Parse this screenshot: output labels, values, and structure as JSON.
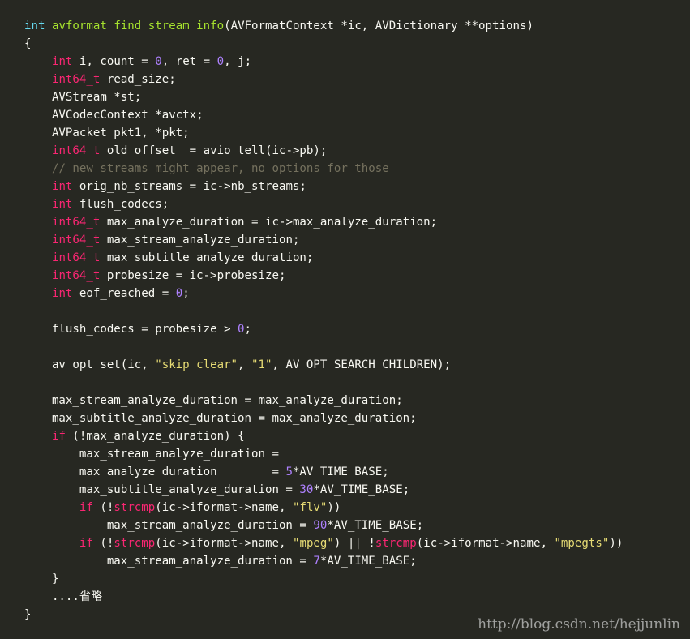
{
  "code": {
    "lines": [
      [
        {
          "t": "int",
          "c": "kw"
        },
        {
          "t": " "
        },
        {
          "t": "avformat_find_stream_info",
          "c": "fn"
        },
        {
          "t": "(AVFormatContext *ic, AVDictionary **options)"
        }
      ],
      [
        {
          "t": "{"
        }
      ],
      [
        {
          "t": "    "
        },
        {
          "t": "int",
          "c": "ty"
        },
        {
          "t": " i, count = "
        },
        {
          "t": "0",
          "c": "num"
        },
        {
          "t": ", ret = "
        },
        {
          "t": "0",
          "c": "num"
        },
        {
          "t": ", j;"
        }
      ],
      [
        {
          "t": "    "
        },
        {
          "t": "int64_t",
          "c": "ty"
        },
        {
          "t": " read_size;"
        }
      ],
      [
        {
          "t": "    AVStream *st;"
        }
      ],
      [
        {
          "t": "    AVCodecContext *avctx;"
        }
      ],
      [
        {
          "t": "    AVPacket pkt1, *pkt;"
        }
      ],
      [
        {
          "t": "    "
        },
        {
          "t": "int64_t",
          "c": "ty"
        },
        {
          "t": " old_offset  = avio_tell(ic->pb);"
        }
      ],
      [
        {
          "t": "    "
        },
        {
          "t": "// new streams might appear, no options for those",
          "c": "cm"
        }
      ],
      [
        {
          "t": "    "
        },
        {
          "t": "int",
          "c": "ty"
        },
        {
          "t": " orig_nb_streams = ic->nb_streams;"
        }
      ],
      [
        {
          "t": "    "
        },
        {
          "t": "int",
          "c": "ty"
        },
        {
          "t": " flush_codecs;"
        }
      ],
      [
        {
          "t": "    "
        },
        {
          "t": "int64_t",
          "c": "ty"
        },
        {
          "t": " max_analyze_duration = ic->max_analyze_duration;"
        }
      ],
      [
        {
          "t": "    "
        },
        {
          "t": "int64_t",
          "c": "ty"
        },
        {
          "t": " max_stream_analyze_duration;"
        }
      ],
      [
        {
          "t": "    "
        },
        {
          "t": "int64_t",
          "c": "ty"
        },
        {
          "t": " max_subtitle_analyze_duration;"
        }
      ],
      [
        {
          "t": "    "
        },
        {
          "t": "int64_t",
          "c": "ty"
        },
        {
          "t": " probesize = ic->probesize;"
        }
      ],
      [
        {
          "t": "    "
        },
        {
          "t": "int",
          "c": "ty"
        },
        {
          "t": " eof_reached = "
        },
        {
          "t": "0",
          "c": "num"
        },
        {
          "t": ";"
        }
      ],
      [
        {
          "t": ""
        }
      ],
      [
        {
          "t": "    flush_codecs = probesize > "
        },
        {
          "t": "0",
          "c": "num"
        },
        {
          "t": ";"
        }
      ],
      [
        {
          "t": ""
        }
      ],
      [
        {
          "t": "    av_opt_set(ic, "
        },
        {
          "t": "\"skip_clear\"",
          "c": "str"
        },
        {
          "t": ", "
        },
        {
          "t": "\"1\"",
          "c": "str"
        },
        {
          "t": ", AV_OPT_SEARCH_CHILDREN);"
        }
      ],
      [
        {
          "t": ""
        }
      ],
      [
        {
          "t": "    max_stream_analyze_duration = max_analyze_duration;"
        }
      ],
      [
        {
          "t": "    max_subtitle_analyze_duration = max_analyze_duration;"
        }
      ],
      [
        {
          "t": "    "
        },
        {
          "t": "if",
          "c": "ty"
        },
        {
          "t": " (!max_analyze_duration) {"
        }
      ],
      [
        {
          "t": "        max_stream_analyze_duration ="
        }
      ],
      [
        {
          "t": "        max_analyze_duration        = "
        },
        {
          "t": "5",
          "c": "num"
        },
        {
          "t": "*AV_TIME_BASE;"
        }
      ],
      [
        {
          "t": "        max_subtitle_analyze_duration = "
        },
        {
          "t": "30",
          "c": "num"
        },
        {
          "t": "*AV_TIME_BASE;"
        }
      ],
      [
        {
          "t": "        "
        },
        {
          "t": "if",
          "c": "ty"
        },
        {
          "t": " (!"
        },
        {
          "t": "strcmp",
          "c": "ty"
        },
        {
          "t": "(ic->iformat->name, "
        },
        {
          "t": "\"flv\"",
          "c": "str"
        },
        {
          "t": "))"
        }
      ],
      [
        {
          "t": "            max_stream_analyze_duration = "
        },
        {
          "t": "90",
          "c": "num"
        },
        {
          "t": "*AV_TIME_BASE;"
        }
      ],
      [
        {
          "t": "        "
        },
        {
          "t": "if",
          "c": "ty"
        },
        {
          "t": " (!"
        },
        {
          "t": "strcmp",
          "c": "ty"
        },
        {
          "t": "(ic->iformat->name, "
        },
        {
          "t": "\"mpeg\"",
          "c": "str"
        },
        {
          "t": ") || !"
        },
        {
          "t": "strcmp",
          "c": "ty"
        },
        {
          "t": "(ic->iformat->name, "
        },
        {
          "t": "\"mpegts\"",
          "c": "str"
        },
        {
          "t": "))"
        }
      ],
      [
        {
          "t": "            max_stream_analyze_duration = "
        },
        {
          "t": "7",
          "c": "num"
        },
        {
          "t": "*AV_TIME_BASE;"
        }
      ],
      [
        {
          "t": "    }"
        }
      ],
      [
        {
          "t": "    ....省略"
        }
      ],
      [
        {
          "t": "}"
        }
      ]
    ]
  },
  "watermark": "http://blog.csdn.net/hejjunlin",
  "colors": {
    "background": "#272822",
    "text": "#f8f8f2",
    "keyword_blue": "#66d9ef",
    "type_pink": "#f92672",
    "function_green": "#a6e22e",
    "number_purple": "#ae81ff",
    "string_yellow": "#e6db74",
    "comment_gray": "#75715e"
  }
}
